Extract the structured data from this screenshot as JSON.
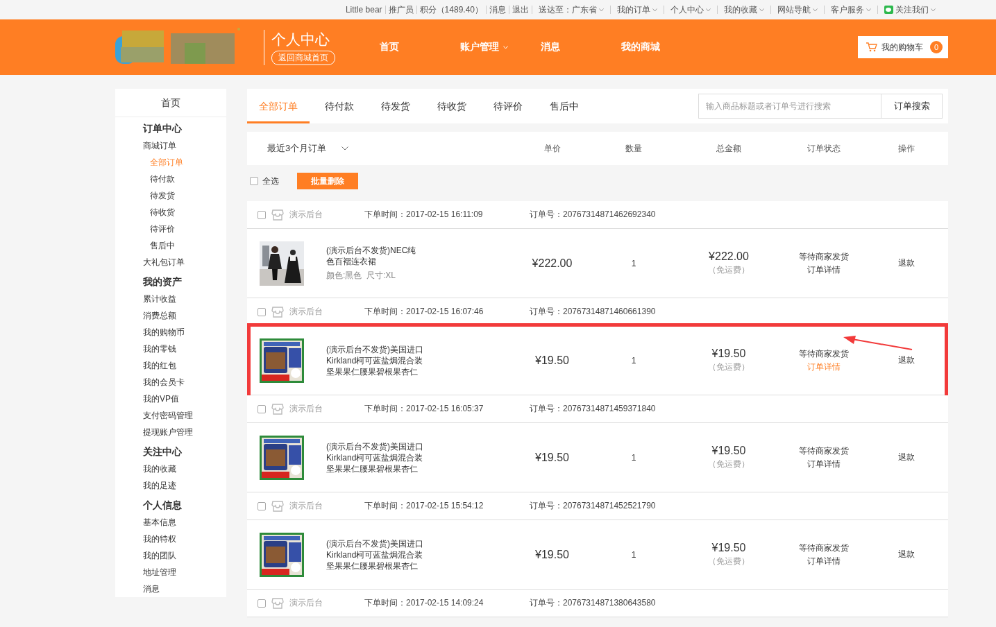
{
  "top_bar": {
    "links": [
      {
        "label": "Little bear",
        "dropdown": false
      },
      {
        "label": "推广员",
        "dropdown": false
      },
      {
        "label": "积分（1489.40）",
        "dropdown": false
      },
      {
        "label": "消息",
        "dropdown": false
      },
      {
        "label": "退出",
        "dropdown": false
      },
      {
        "label": "送达至：广东省",
        "dropdown": true
      },
      {
        "label": "我的订单",
        "dropdown": true
      },
      {
        "label": "个人中心",
        "dropdown": true
      },
      {
        "label": "我的收藏",
        "dropdown": true
      },
      {
        "label": "网站导航",
        "dropdown": true
      },
      {
        "label": "客户服务",
        "dropdown": true
      },
      {
        "label": "关注我们",
        "dropdown": true
      }
    ]
  },
  "header": {
    "title": "个人中心",
    "back_link": "返回商城首页",
    "nav": [
      {
        "label": "首页",
        "dropdown": false
      },
      {
        "label": "账户管理",
        "dropdown": true
      },
      {
        "label": "消息",
        "dropdown": false
      },
      {
        "label": "我的商城",
        "dropdown": false
      }
    ],
    "cart": {
      "label": "我的购物车",
      "count": "0"
    }
  },
  "sidebar": {
    "home": "首页",
    "sections": [
      {
        "title": "订单中心",
        "items": [
          {
            "label": "商城订单",
            "selected": false,
            "children": [
              {
                "label": "全部订单",
                "selected": true
              },
              {
                "label": "待付款",
                "selected": false
              },
              {
                "label": "待发货",
                "selected": false
              },
              {
                "label": "待收货",
                "selected": false
              },
              {
                "label": "待评价",
                "selected": false
              },
              {
                "label": "售后中",
                "selected": false
              }
            ]
          },
          {
            "label": "大礼包订单",
            "selected": false
          }
        ]
      },
      {
        "title": "我的资产",
        "items": [
          {
            "label": "累计收益",
            "selected": false
          },
          {
            "label": "消费总额",
            "selected": false
          },
          {
            "label": "我的购物币",
            "selected": false
          },
          {
            "label": "我的零钱",
            "selected": false
          },
          {
            "label": "我的红包",
            "selected": false
          },
          {
            "label": "我的会员卡",
            "selected": false
          },
          {
            "label": "我的VP值",
            "selected": false
          },
          {
            "label": "支付密码管理",
            "selected": false
          },
          {
            "label": "提现账户管理",
            "selected": false
          }
        ]
      },
      {
        "title": "关注中心",
        "items": [
          {
            "label": "我的收藏",
            "selected": false
          },
          {
            "label": "我的足迹",
            "selected": false
          }
        ]
      },
      {
        "title": "个人信息",
        "items": [
          {
            "label": "基本信息",
            "selected": false
          },
          {
            "label": "我的特权",
            "selected": false
          },
          {
            "label": "我的团队",
            "selected": false
          },
          {
            "label": "地址管理",
            "selected": false
          },
          {
            "label": "消息",
            "selected": false
          }
        ]
      }
    ]
  },
  "tabs": [
    {
      "label": "全部订单",
      "selected": true
    },
    {
      "label": "待付款",
      "selected": false
    },
    {
      "label": "待发货",
      "selected": false
    },
    {
      "label": "待收货",
      "selected": false
    },
    {
      "label": "待评价",
      "selected": false
    },
    {
      "label": "售后中",
      "selected": false
    }
  ],
  "search": {
    "placeholder": "输入商品标题或者订单号进行搜索",
    "button": "订单搜索"
  },
  "table": {
    "period": "最近3个月订单",
    "columns": [
      "单价",
      "数量",
      "总金额",
      "订单状态",
      "操作"
    ]
  },
  "bulk": {
    "select_all": "全选",
    "checked": false,
    "delete_button": "批量删除"
  },
  "orders": [
    {
      "checked": false,
      "shop": "演示后台",
      "time": "下单时间：2017-02-15 16:11:09",
      "order_no": "订单号：20767314871462692340",
      "annotated": false,
      "item": {
        "title": "(演示后台不发货)NEC纯色百褶连衣裙",
        "spec": "颜色:黑色  尺寸:XL",
        "price": "¥222.00",
        "qty": "1",
        "total": "¥222.00",
        "shipping": "（免运费）",
        "status": "等待商家发货",
        "detail": "订单详情",
        "action": "退款"
      }
    },
    {
      "checked": false,
      "shop": "演示后台",
      "time": "下单时间：2017-02-15 16:07:46",
      "order_no": "订单号：20767314871460661390",
      "annotated": true,
      "item": {
        "title": "(演示后台不发货)美国进口Kirkland柯可蓝盐焗混合装坚果果仁腰果碧根果杏仁",
        "price": "¥19.50",
        "qty": "1",
        "total": "¥19.50",
        "shipping": "（免运费）",
        "status": "等待商家发货",
        "detail": "订单详情",
        "action": "退款"
      }
    },
    {
      "checked": false,
      "shop": "演示后台",
      "time": "下单时间：2017-02-15 16:05:37",
      "order_no": "订单号：20767314871459371840",
      "annotated": false,
      "item": {
        "title": "(演示后台不发货)美国进口Kirkland柯可蓝盐焗混合装坚果果仁腰果碧根果杏仁",
        "price": "¥19.50",
        "qty": "1",
        "total": "¥19.50",
        "shipping": "（免运费）",
        "status": "等待商家发货",
        "detail": "订单详情",
        "action": "退款"
      }
    },
    {
      "checked": false,
      "shop": "演示后台",
      "time": "下单时间：2017-02-15 15:54:12",
      "order_no": "订单号：20767314871452521790",
      "annotated": false,
      "item": {
        "title": "(演示后台不发货)美国进口Kirkland柯可蓝盐焗混合装坚果果仁腰果碧根果杏仁",
        "price": "¥19.50",
        "qty": "1",
        "total": "¥19.50",
        "shipping": "（免运费）",
        "status": "等待商家发货",
        "detail": "订单详情",
        "action": "退款"
      }
    },
    {
      "checked": false,
      "shop": "演示后台",
      "time": "下单时间：2017-02-15 14:09:24",
      "order_no": "订单号：20767314871380643580",
      "annotated": false
    }
  ]
}
